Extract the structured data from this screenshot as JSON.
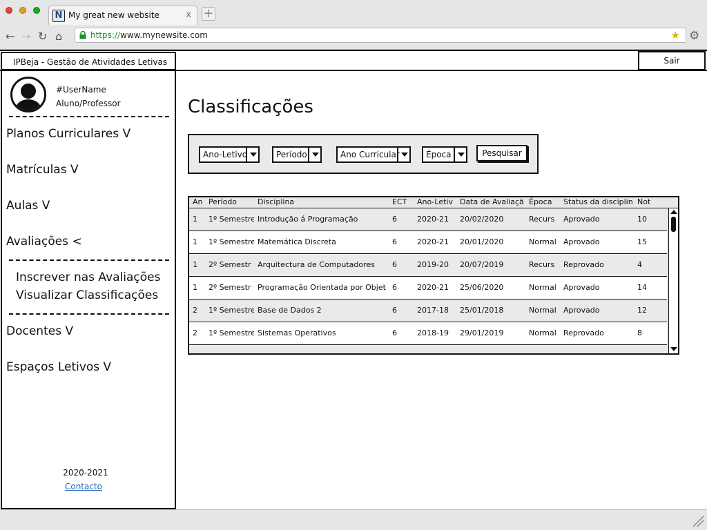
{
  "browser": {
    "tab_logo": "N",
    "tab_title": "My great new website",
    "tab_close": "x",
    "new_tab": "+",
    "url_protocol": "https://",
    "url_rest": "www.mynewsite.com",
    "icons": [
      "back-icon",
      "forward-icon",
      "reload-icon",
      "home-icon",
      "lock-icon",
      "bookmark-star-icon",
      "settings-gear-icon"
    ]
  },
  "header": {
    "brand": "IPBeja - Gestão de Atividades Letivas",
    "logout_label": "Sair"
  },
  "sidebar": {
    "username": "#UserName",
    "role": "Aluno/Professor",
    "menu": [
      {
        "label": "Planos Curriculares V"
      },
      {
        "label": "Matrículas V"
      },
      {
        "label": "Aulas V"
      },
      {
        "label": "Avaliações <"
      },
      {
        "label": "Docentes V"
      },
      {
        "label": "Espaços Letivos V"
      }
    ],
    "submenu": [
      {
        "label": "Inscrever nas Avaliações"
      },
      {
        "label": "Visualizar Classificações"
      }
    ],
    "year": "2020-2021",
    "contact": "Contacto"
  },
  "main": {
    "title": "Classificações",
    "filters": [
      {
        "label": "Ano-Letivo"
      },
      {
        "label": "Período"
      },
      {
        "label": "Ano Curricular"
      },
      {
        "label": "Época"
      }
    ],
    "search_label": "Pesquisar",
    "table": {
      "headers": [
        "An",
        "Período",
        "Disciplina",
        "ECT",
        "Ano-Letiv",
        "Data de Avaliaçã",
        "Época",
        "Status da disciplin",
        "Not"
      ],
      "rows": [
        [
          "1",
          "1º Semestre",
          "Introdução á Programação",
          "6",
          "2020-21",
          "20/02/2020",
          "Recurs",
          "Aprovado",
          "10"
        ],
        [
          "1",
          "1º Semestre",
          "Matemática Discreta",
          "6",
          "2020-21",
          "20/01/2020",
          "Normal",
          "Aprovado",
          "15"
        ],
        [
          "1",
          "2º Semestr",
          "Arquitectura de Computadores",
          "6",
          "2019-20",
          "20/07/2019",
          "Recurs",
          "Reprovado",
          "4"
        ],
        [
          "1",
          "2º Semestr",
          "Programação Orientada por Objet",
          "6",
          "2020-21",
          "25/06/2020",
          "Normal",
          "Aprovado",
          "14"
        ],
        [
          "2",
          "1º Semestre",
          "Base de Dados 2",
          "6",
          "2017-18",
          "25/01/2018",
          "Normal",
          "Aprovado",
          "12"
        ],
        [
          "2",
          "1º Semestre",
          "Sistemas Operativos",
          "6",
          "2018-19",
          "29/01/2019",
          "Normal",
          "Reprovado",
          "8"
        ]
      ]
    }
  }
}
